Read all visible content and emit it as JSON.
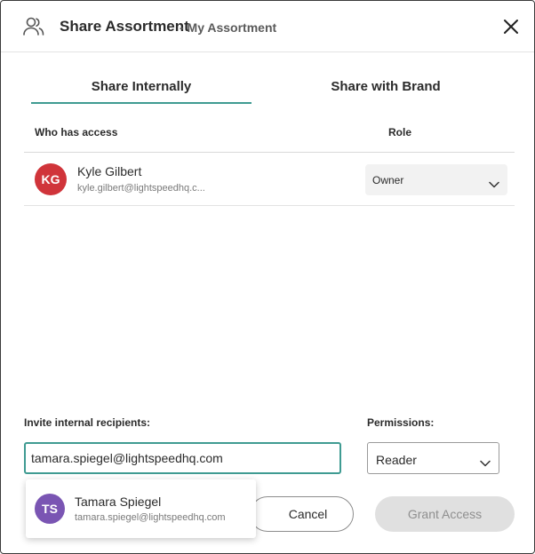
{
  "header": {
    "title": "Share Assortment",
    "subtitle": "- My Assortment",
    "icon": "users-icon",
    "close_icon": "close-icon"
  },
  "tabs": [
    {
      "label": "Share Internally",
      "active": true
    },
    {
      "label": "Share with Brand",
      "active": false
    }
  ],
  "access_table": {
    "columns": [
      "Who has access",
      "Role"
    ],
    "rows": [
      {
        "initials": "KG",
        "name": "Kyle Gilbert",
        "email": "kyle.gilbert@lightspeedhq.c...",
        "role": "Owner",
        "avatar_color": "#d0343a"
      }
    ]
  },
  "invite": {
    "label": "Invite internal recipients:",
    "value": "tamara.spiegel@lightspeedhq.com"
  },
  "permissions": {
    "label": "Permissions:",
    "value": "Reader"
  },
  "suggestion": {
    "initials": "TS",
    "name": "Tamara Spiegel",
    "email": "tamara.spiegel@lightspeedhq.com",
    "avatar_color": "#7a55b3"
  },
  "buttons": {
    "cancel": "Cancel",
    "grant": "Grant Access"
  },
  "colors": {
    "accent": "#3f9b92",
    "disabled_bg": "#e0e0e0"
  }
}
